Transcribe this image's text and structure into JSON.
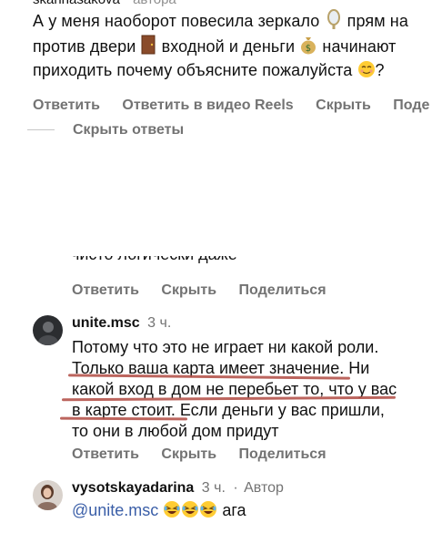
{
  "comment1": {
    "author_partial": "skarinasakova",
    "author_tag": "автора",
    "text": "А у меня наоборот повесила зеркало",
    "text_after_mirror": "прям на против двери",
    "text_after_door": "входной и деньги",
    "text_after_money": "начинают приходить почему объясните пожалуйста",
    "text_end": "?",
    "actions": [
      "Ответить",
      "Ответить в видео Reels",
      "Скрыть",
      "Поде"
    ],
    "hide_replies": "Скрыть ответы"
  },
  "comment2_cutoff": {
    "text": "чисто логически даже",
    "actions": [
      "Ответить",
      "Скрыть",
      "Поделиться"
    ]
  },
  "comment3": {
    "username": "unite.msc",
    "time": "3 ч.",
    "line1": "Потому что это не играет ни какой роли.",
    "line2": "Только ваша карта имеет значение. Ни",
    "line3": "какой вход в дом не перебьет то, что у вас",
    "line4": "в карте стоит. Если деньги у вас пришли,",
    "line5": "то они в любой дом придут",
    "actions": [
      "Ответить",
      "Скрыть",
      "Поделиться"
    ]
  },
  "comment4": {
    "username": "vysotskayadarina",
    "time": "3 ч.",
    "author_label": "Автор",
    "mention": "@unite.msc",
    "text": "ага"
  },
  "colors": {
    "action_gray": "#737373",
    "mention_blue": "#3b5fa8",
    "underline_red": "#b5544d"
  }
}
